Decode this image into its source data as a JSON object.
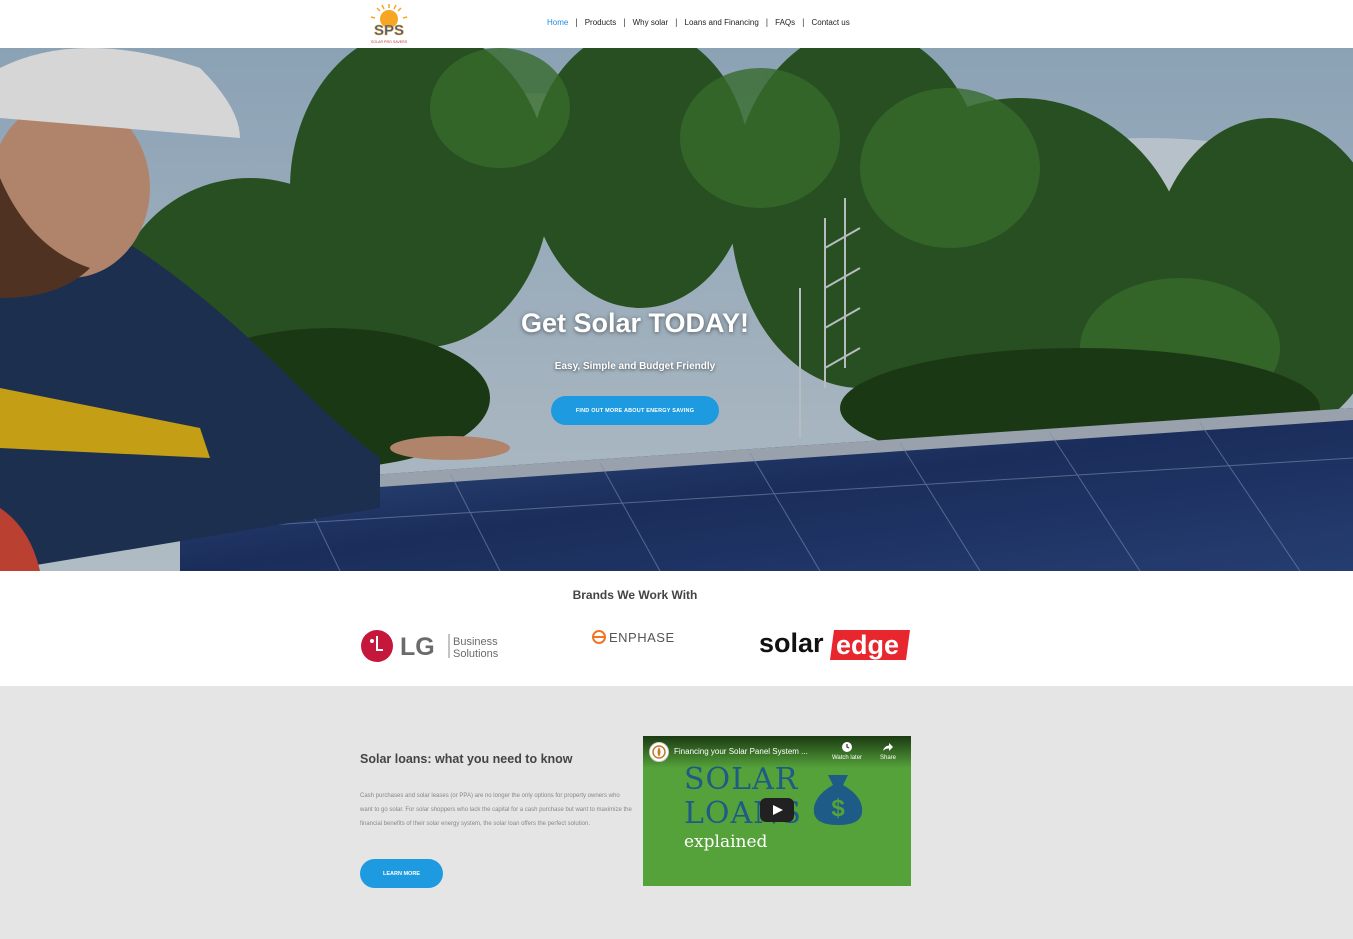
{
  "header": {
    "logo_text": "SPS",
    "logo_tagline": "SOLAR PRO SAVERS",
    "nav": [
      {
        "label": "Home",
        "active": true
      },
      {
        "label": "Products",
        "active": false
      },
      {
        "label": "Why solar",
        "active": false
      },
      {
        "label": "Loans and Financing",
        "active": false
      },
      {
        "label": "FAQs",
        "active": false
      },
      {
        "label": "Contact us",
        "active": false
      }
    ],
    "separator": "|"
  },
  "hero": {
    "title": "Get Solar TODAY!",
    "subtitle": "Easy, Simple and Budget Friendly",
    "cta_label": "FIND OUT MORE ABOUT ENERGY SAVING"
  },
  "brands": {
    "title": "Brands We Work With",
    "items": [
      {
        "name": "LG",
        "line1": "Business",
        "line2": "Solutions"
      },
      {
        "name": "ENPHASE"
      },
      {
        "name_part1": "solar",
        "name_part2": "edge"
      }
    ]
  },
  "loans": {
    "title": "Solar loans: what you need to know",
    "body": "Cash purchases and solar leases (or PPA) are no longer the only options for property owners who want to go solar. For solar shoppers who lack the capital for a cash purchase but want to maximize the financial benefits of their solar energy system, the solar loan offers the perfect solution.",
    "cta_label": "LEARN MORE",
    "video": {
      "title": "Financing your Solar Panel System ...",
      "watch_later": "Watch later",
      "share": "Share",
      "thumb_line1": "SOLAR",
      "thumb_line2": "LOANS",
      "thumb_line3": "explained",
      "bag_symbol": "$"
    }
  },
  "colors": {
    "accent": "#1e9ae0",
    "nav_active": "#1f8ae0",
    "section_bg": "#e5e5e5",
    "video_bg": "#55a23a"
  }
}
